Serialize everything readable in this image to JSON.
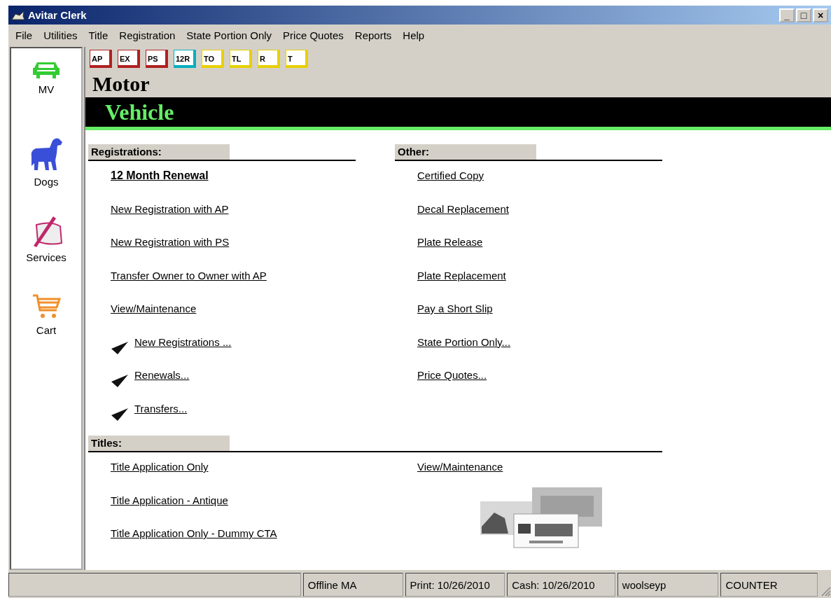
{
  "window": {
    "title": "Avitar Clerk",
    "controls": [
      "_",
      "□",
      "×"
    ]
  },
  "menu": [
    "File",
    "Utilities",
    "Title",
    "Registration",
    "State Portion Only",
    "Price Quotes",
    "Reports",
    "Help"
  ],
  "sidebar": [
    {
      "label": "MV",
      "kind": "car"
    },
    {
      "label": "Dogs",
      "kind": "dog"
    },
    {
      "label": "Services",
      "kind": "pen"
    },
    {
      "label": "Cart",
      "kind": "cart"
    }
  ],
  "toolbar": [
    {
      "label": "AP",
      "color": "#b02020"
    },
    {
      "label": "EX",
      "color": "#b02020"
    },
    {
      "label": "PS",
      "color": "#b02020"
    },
    {
      "label": "12R",
      "color": "#00b0c0"
    },
    {
      "label": "TO",
      "color": "#e8d000"
    },
    {
      "label": "TL",
      "color": "#e8d000"
    },
    {
      "label": "R",
      "color": "#e8d000"
    },
    {
      "label": "T",
      "color": "#e8d000"
    }
  ],
  "heading": {
    "line_1": "Motor",
    "line_2": "Vehicle"
  },
  "sections": [
    {
      "title": "Registrations:",
      "columns": [
        [
          {
            "label": "12 Month Renewal",
            "kind": "primary"
          },
          {
            "label": "New Registration with AP",
            "kind": "link"
          },
          {
            "label": "New Registration with PS",
            "kind": "link"
          },
          {
            "label": "Transfer Owner to Owner with AP",
            "kind": "link"
          },
          {
            "label": "View/Maintenance",
            "kind": "link"
          },
          {
            "label": "New Registrations ...",
            "kind": "submenu"
          },
          {
            "label": "Renewals...",
            "kind": "submenu"
          },
          {
            "label": "Transfers...",
            "kind": "submenu"
          }
        ]
      ],
      "other_title": "Other:",
      "other": [
        "Certified Copy",
        "Decal Replacement",
        "Plate Release",
        "Plate Replacement",
        "Pay a Short Slip",
        "State Portion Only...",
        "Price Quotes..."
      ]
    },
    {
      "title": "Titles:",
      "columns": [
        [
          {
            "label": "Title Application Only",
            "kind": "link"
          },
          {
            "label": "Title Application - Antique",
            "kind": "link"
          },
          {
            "label": "Title Application Only - Dummy CTA",
            "kind": "link"
          }
        ]
      ],
      "other": [
        "View/Maintenance"
      ],
      "picture": {
        "kind": "picture"
      }
    }
  ],
  "status_bar": [
    "Offline MA",
    "Print: 10/26/2010",
    "Cash: 10/26/2010",
    "woolseyp",
    "COUNTER"
  ]
}
